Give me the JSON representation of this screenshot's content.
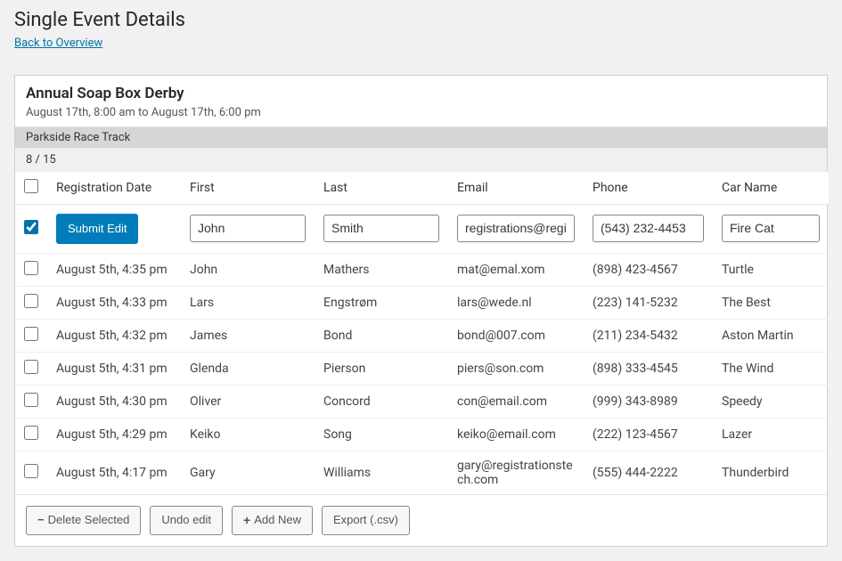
{
  "page_title": "Single Event Details",
  "back_link": "Back to Overview",
  "event": {
    "title": "Annual Soap Box Derby",
    "date_range": "August 17th, 8:00 am to August 17th, 6:00 pm",
    "venue": "Parkside Race Track",
    "count": "8 / 15"
  },
  "columns": {
    "reg_date": "Registration Date",
    "first": "First",
    "last": "Last",
    "email": "Email",
    "phone": "Phone",
    "car": "Car Name"
  },
  "edit_row": {
    "submit_label": "Submit Edit",
    "first": "John",
    "last": "Smith",
    "email": "registrations@registrationstech.com",
    "phone": "(543) 232-4453",
    "car": "Fire Cat"
  },
  "rows": [
    {
      "date": "August 5th, 4:35 pm",
      "first": "John",
      "last": "Mathers",
      "email": "mat@emal.xom",
      "phone": "(898) 423-4567",
      "car": "Turtle"
    },
    {
      "date": "August 5th, 4:33 pm",
      "first": "Lars",
      "last": "Engstrøm",
      "email": "lars@wede.nl",
      "phone": "(223) 141-5232",
      "car": "The Best"
    },
    {
      "date": "August 5th, 4:32 pm",
      "first": "James",
      "last": "Bond",
      "email": "bond@007.com",
      "phone": "(211) 234-5432",
      "car": "Aston Martin"
    },
    {
      "date": "August 5th, 4:31 pm",
      "first": "Glenda",
      "last": "Pierson",
      "email": "piers@son.com",
      "phone": "(898) 333-4545",
      "car": "The Wind"
    },
    {
      "date": "August 5th, 4:30 pm",
      "first": "Oliver",
      "last": "Concord",
      "email": "con@email.com",
      "phone": "(999) 343-8989",
      "car": "Speedy"
    },
    {
      "date": "August 5th, 4:29 pm",
      "first": "Keiko",
      "last": "Song",
      "email": "keiko@email.com",
      "phone": "(222) 123-4567",
      "car": "Lazer"
    },
    {
      "date": "August 5th, 4:17 pm",
      "first": "Gary",
      "last": "Williams",
      "email": "gary@registrationstech.com",
      "phone": "(555) 444-2222",
      "car": "Thunderbird"
    }
  ],
  "footer": {
    "delete": "Delete Selected",
    "undo": "Undo edit",
    "add": "Add New",
    "export": "Export (.csv)"
  }
}
